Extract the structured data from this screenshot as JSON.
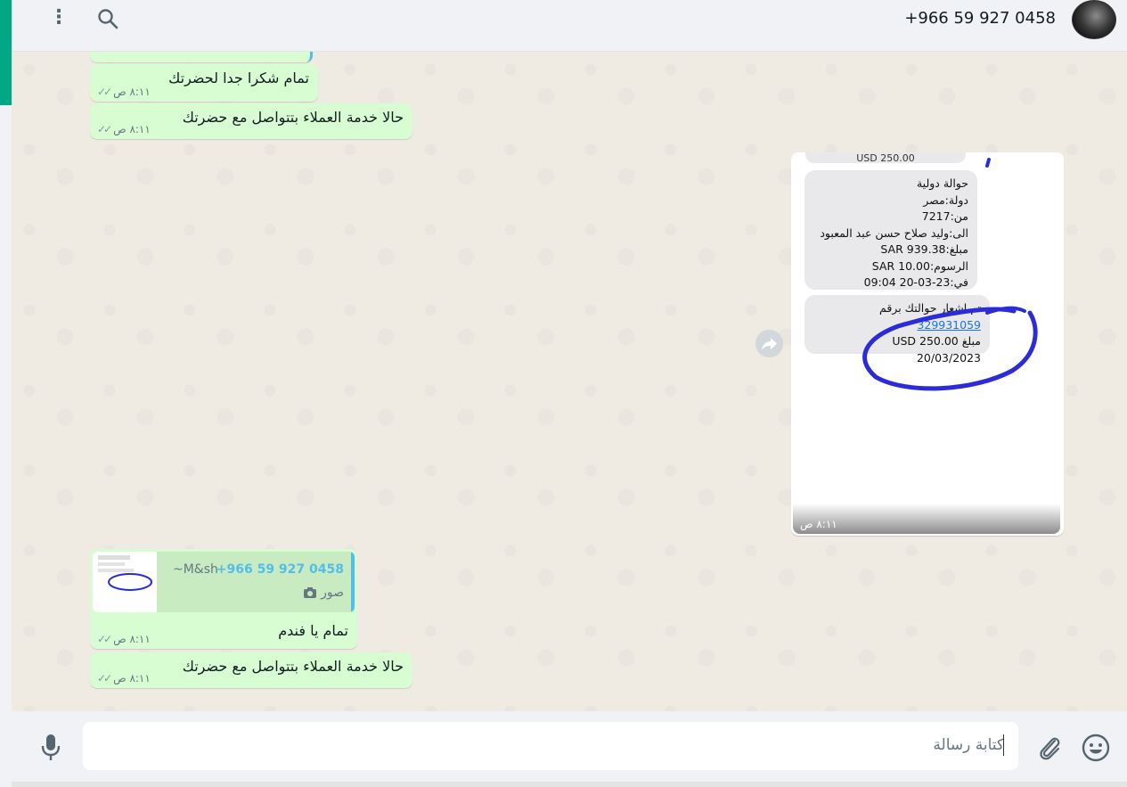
{
  "header": {
    "contact_phone": "+966 59 927 0458",
    "menu_glyph": "⋮"
  },
  "messages": {
    "m1": {
      "text": "تمام شكرا جدا لحضرتك",
      "time": "٨:١١ ص"
    },
    "m2": {
      "text": "حالا خدمة العملاء بتتواصل مع حضرتك",
      "time": "٨:١١ ص"
    },
    "image": {
      "time": "٨:١١ ص",
      "top_clip": "USD 250.00",
      "transfer": {
        "line1": "حوالة دولية",
        "line2": "دولة:مصر",
        "line3": "من:7217",
        "line4": "الى:وليد صلاح حسن عبد المعبود",
        "line5": "مبلغ:SAR 939.38",
        "line6": "الرسوم:SAR 10.00",
        "line7": "في:23-03-20 09:04"
      },
      "confirmation": {
        "line1_prefix": "تم اشعار حوالتك برقم",
        "line1_number": "329931059",
        "line2": "مبلغ USD 250.00",
        "line3": "20/03/2023"
      }
    },
    "m3": {
      "quote_name": "+966 59 927 0458",
      "quote_pushname": "~M&sh",
      "quote_kind": "صور",
      "text": "تمام يا فندم",
      "time": "٨:١١ ص"
    },
    "m4": {
      "text": "حالا خدمة العملاء بتتواصل مع حضرتك",
      "time": "٨:١١ ص"
    }
  },
  "composer": {
    "placeholder": "كتابة رسالة"
  },
  "colors": {
    "accent": "#00a884",
    "outgoing_bubble": "#d9fdd3",
    "link": "#53bdeb",
    "scribble": "#2b2bd9"
  }
}
